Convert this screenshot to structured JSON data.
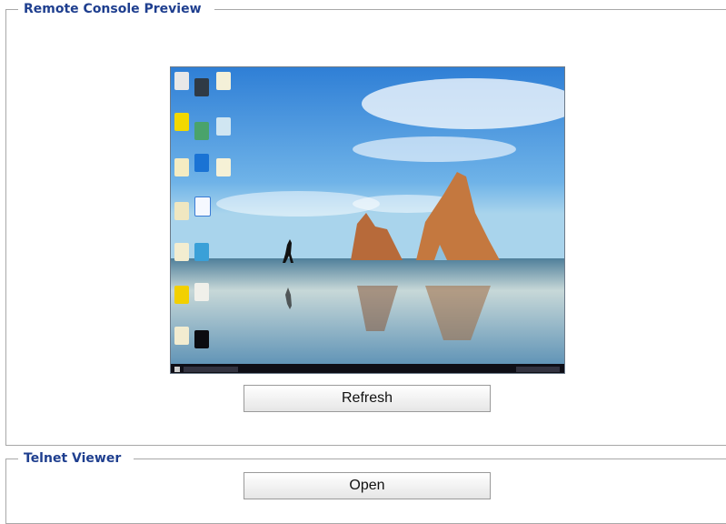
{
  "sections": {
    "preview": {
      "legend": "Remote Console Preview",
      "refresh_label": "Refresh"
    },
    "telnet": {
      "legend": "Telnet Viewer",
      "open_label": "Open"
    }
  },
  "colors": {
    "legend_text": "#1f3f8f",
    "border": "#a8a8a8"
  }
}
